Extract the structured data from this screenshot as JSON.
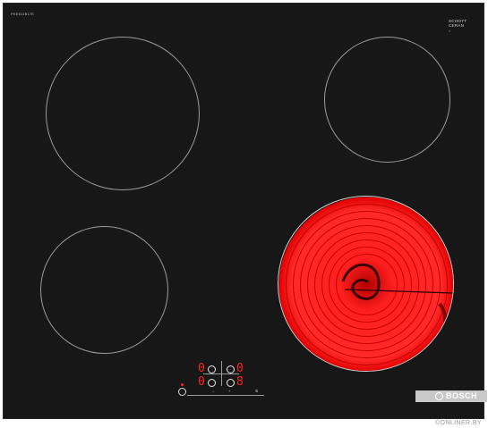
{
  "product": {
    "model_label": "PKE611B17E",
    "glass_brand_line1": "SCHOTT",
    "glass_brand_line2": "CERAN",
    "glass_brand_sub": "®"
  },
  "zones": [
    {
      "name": "front-left-zone",
      "state": "off"
    },
    {
      "name": "rear-right-zone",
      "state": "off"
    },
    {
      "name": "rear-left-zone",
      "state": "off"
    },
    {
      "name": "front-right-zone",
      "state": "on"
    }
  ],
  "control_panel": {
    "left_display": "0",
    "right_display": "0",
    "left_display_2": "0",
    "right_display_2": "8",
    "minus_label": "–",
    "plus_label": "+",
    "timer_label": "⏲"
  },
  "brand": {
    "name": "BOSCH"
  },
  "watermark": {
    "text": "©ONLINER.BY"
  },
  "colors": {
    "glass": "#171717",
    "zone_outline": "#9a9a9a",
    "hot_zone": "#ff1a1a",
    "display": "#ff2020",
    "brand_bar": "#c9c9c9"
  }
}
